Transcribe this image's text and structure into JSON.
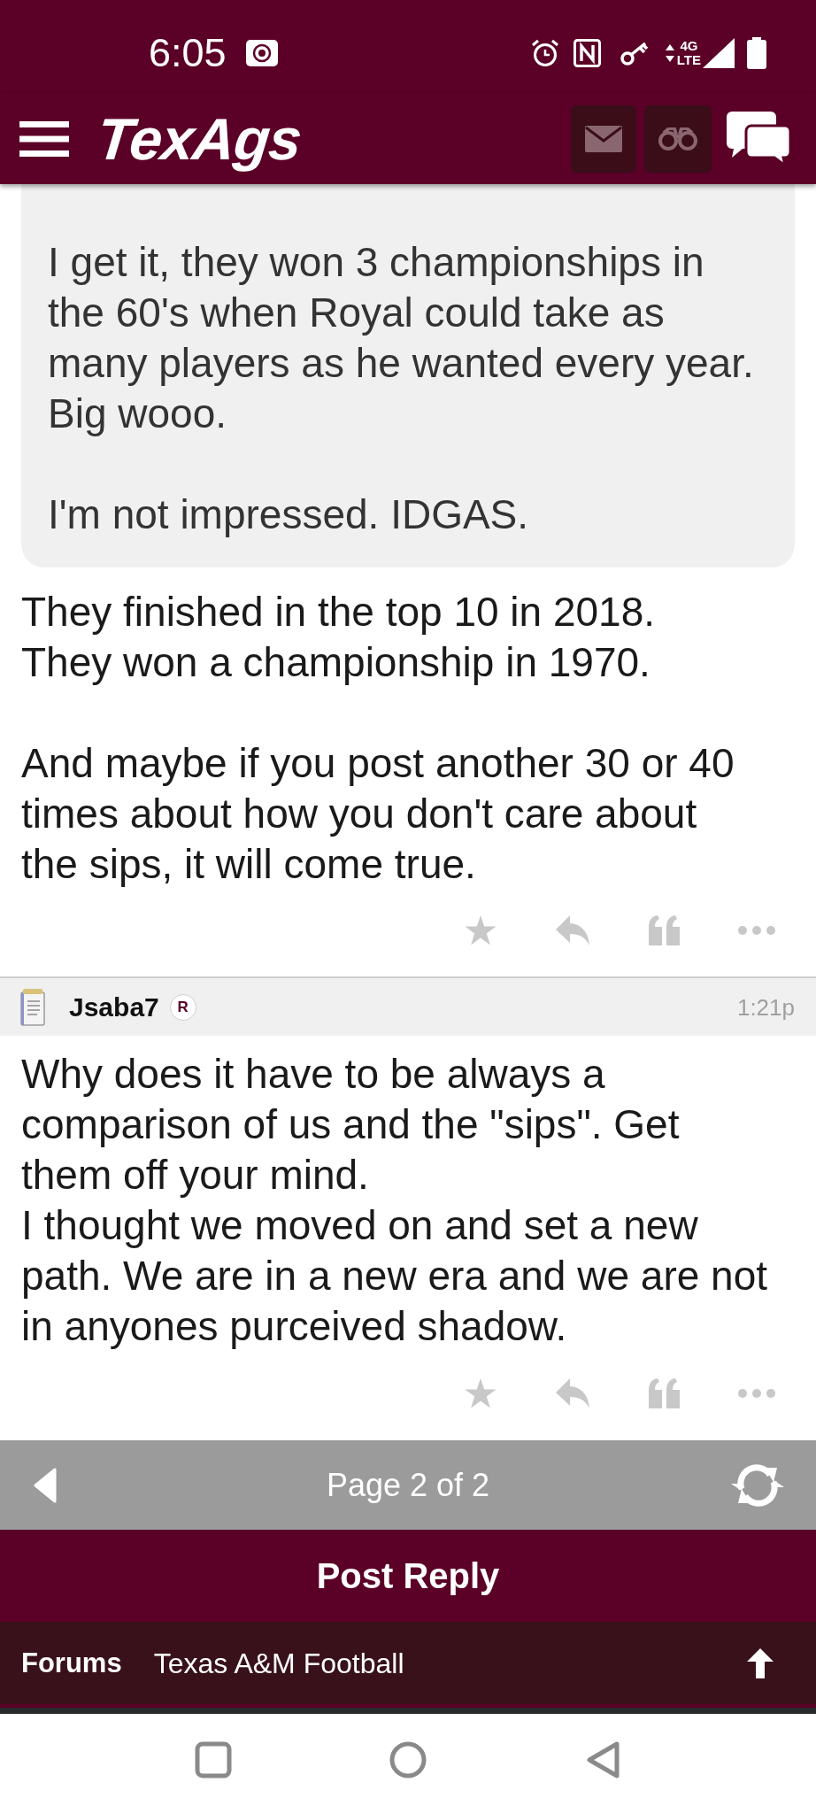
{
  "status_bar": {
    "time": "6:05",
    "network_type": [
      "4G",
      "LTE"
    ]
  },
  "header": {
    "logo": "TexAgs"
  },
  "posts": [
    {
      "quote": {
        "paragraphs": [
          "I get it, they won 3 championships in\nthe 60's when Royal could take as\nmany players as he wanted every year.\nBig wooo.",
          "I'm not impressed. IDGAS."
        ]
      },
      "paragraphs": [
        "They finished in the top 10 in 2018.\nThey won a championship in 1970.",
        "And maybe if you post another 30 or 40\ntimes about how you don't care about\nthe sips, it will come true."
      ]
    },
    {
      "author": {
        "name": "Jsaba7",
        "badge": "R",
        "time": "1:21p"
      },
      "paragraphs": [
        "Why does it have to be always a\ncomparison of us and the \"sips\". Get\nthem off your mind.\nI thought we moved on and set a new\npath. We are in a new era and we are not\nin anyones purceived shadow."
      ]
    }
  ],
  "pager": {
    "label": "Page 2 of 2"
  },
  "post_reply": {
    "label": "Post Reply"
  },
  "breadcrumb": {
    "root": "Forums",
    "forum": "Texas A&M Football"
  }
}
